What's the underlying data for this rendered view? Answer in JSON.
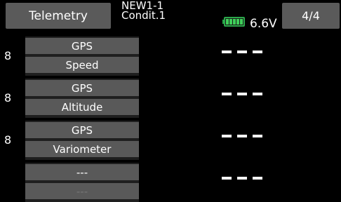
{
  "header": {
    "title": "Telemetry",
    "model_line1": "NEW1-1",
    "model_line2": "Condit.1",
    "battery_voltage": "6.6V",
    "page": "4/4"
  },
  "rows": [
    {
      "number": "8",
      "sensor": "GPS",
      "item": "Speed",
      "value": "---"
    },
    {
      "number": "8",
      "sensor": "GPS",
      "item": "Altitude",
      "value": "---"
    },
    {
      "number": "8",
      "sensor": "GPS",
      "item": "Variometer",
      "value": "---"
    },
    {
      "number": "",
      "sensor": "---",
      "item": "---",
      "value": "---"
    }
  ],
  "colors": {
    "background": "#000000",
    "tab": "#5a5a5a",
    "battery": "#3fd05a"
  }
}
